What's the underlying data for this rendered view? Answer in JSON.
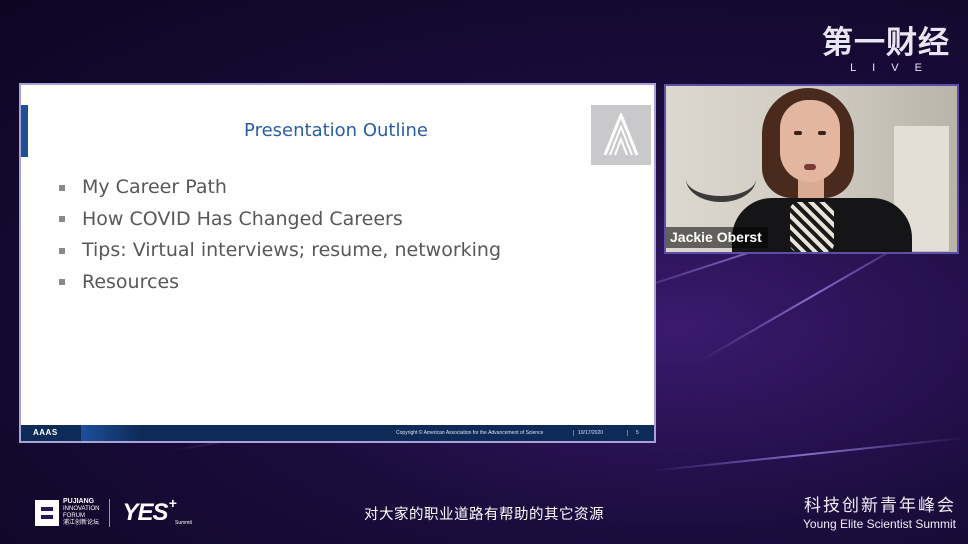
{
  "broadcast_logo": {
    "chinese": "第一财经",
    "sub": "LIVE"
  },
  "slide": {
    "title": "Presentation Outline",
    "bullets": [
      "My Career Path",
      "How COVID Has Changed Careers",
      "Tips: Virtual interviews; resume, networking",
      "Resources"
    ],
    "footer": {
      "org_logo": "AAAS",
      "copyright": "Copyright © American Association for the Advancement of Science",
      "date": "10/17/2020",
      "page": "5"
    }
  },
  "video": {
    "speaker_name": "Jackie Oberst"
  },
  "bottom_left_logo": {
    "pujiang_lines": [
      "PUJIANG",
      "INNOVATION",
      "FORUM",
      "浦江创新论坛"
    ],
    "yes": "YES",
    "yes_plus": "+",
    "yes_sub": "Summit"
  },
  "subtitle": "对大家的职业道路有帮助的其它资源",
  "bottom_right_logo": {
    "chinese": "科技创新青年峰会",
    "english": "Young Elite Scientist Summit"
  },
  "colors": {
    "slide_title": "#2a5ea0",
    "accent_bar": "#1e4f95",
    "footer_bg": "#0e2a57",
    "background": "#1b0c3d"
  }
}
